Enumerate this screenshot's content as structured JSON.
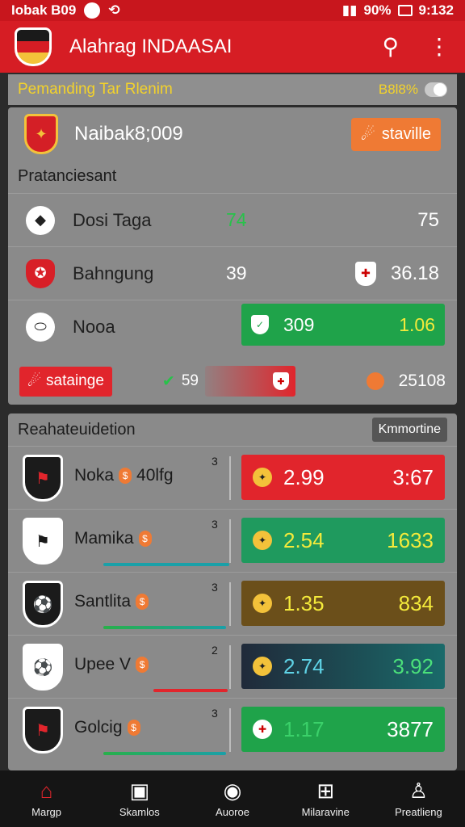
{
  "status_bar": {
    "left_text": "Iobak B09",
    "battery": "90%",
    "time": "9:132"
  },
  "app_bar": {
    "title": "Alahrag INDAASAI",
    "logo_colors": [
      "#1a1a1a",
      "#d61d24",
      "#f3c23a"
    ]
  },
  "filter_bar": {
    "title": "Pemanding Tar Rlenim",
    "right_label": "B8l8%"
  },
  "panel1": {
    "match_title": "Naibak8;009",
    "pill_label": "staville",
    "section_label": "Pratanciesant",
    "rows": [
      {
        "name": "Dosi Taga",
        "v1": "74",
        "v2": "75",
        "v1_color": "#28c24a",
        "v2_color": "#ffffff"
      },
      {
        "name": "Bahngung",
        "v1": "39",
        "v2": "36.18",
        "v1_color": "#ffffff",
        "v2_color": "#ffffff"
      },
      {
        "name": "Nooa",
        "v1": "309",
        "v2": "1.06"
      }
    ],
    "footer": {
      "pill_label": "satainge",
      "mid_value": "59",
      "right_value": "25108"
    }
  },
  "panel2": {
    "title": "Reahateuidetion",
    "button_label": "Kmmortine",
    "rows": [
      {
        "name": "Noka",
        "extra": "40lfg",
        "small": "3",
        "o1": "2.99",
        "o2": "3:67",
        "bg": "#e1252c",
        "o1_color": "#ffffff",
        "o2_color": "#ffffff",
        "under_color": ""
      },
      {
        "name": "Mamika",
        "extra": "",
        "small": "3",
        "o1": "2.54",
        "o2": "1633",
        "bg": "#1f9a5e",
        "o1_color": "#f4ea3b",
        "o2_color": "#f4ea3b",
        "under_color": "#1aa0a8"
      },
      {
        "name": "Santlita",
        "extra": "",
        "small": "3",
        "o1": "1.35",
        "o2": "834",
        "bg": "#6b4f1a",
        "o1_color": "#f4ea3b",
        "o2_color": "#f4ea3b",
        "under_color": "#28b04a"
      },
      {
        "name": "Upee V",
        "extra": "",
        "small": "2",
        "o1": "2.74",
        "o2": "3.92",
        "bg": "#1d3a4a",
        "o1_color": "#5fd3e6",
        "o2_color": "#4be07a",
        "under_color": "#e1252c"
      },
      {
        "name": "Golcig",
        "extra": "",
        "small": "3",
        "o1": "1.17",
        "o2": "3877",
        "bg": "#1fa34a",
        "o1_color": "#3bd16a",
        "o2_color": "#ffffff",
        "under_color": "#28b04a"
      }
    ]
  },
  "bottom_nav": [
    {
      "label": "Margp",
      "icon": "home-icon",
      "glyph": "⌂"
    },
    {
      "label": "Skamlos",
      "icon": "box-icon",
      "glyph": "▣"
    },
    {
      "label": "Auoroe",
      "icon": "ball-icon",
      "glyph": "◉"
    },
    {
      "label": "Milaravine",
      "icon": "chart-icon",
      "glyph": "⊞"
    },
    {
      "label": "Preatlieng",
      "icon": "profile-icon",
      "glyph": "♙"
    }
  ]
}
